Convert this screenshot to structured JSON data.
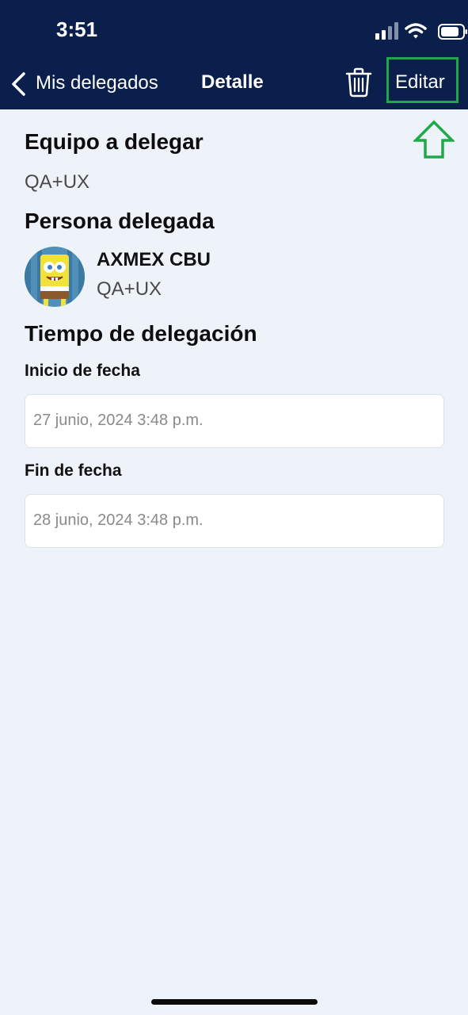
{
  "status_bar": {
    "time": "3:51"
  },
  "nav": {
    "back_label": "Mis delegados",
    "title": "Detalle",
    "edit_label": "Editar"
  },
  "sections": {
    "team_heading": "Equipo a delegar",
    "team_value": "QA+UX",
    "person_heading": "Persona delegada",
    "person_name": "AXMEX CBU",
    "person_team": "QA+UX",
    "time_heading": "Tiempo de delegación"
  },
  "dates": {
    "start_label": "Inicio de fecha",
    "start_value": "27 junio, 2024 3:48 p.m.",
    "end_label": "Fin de fecha",
    "end_value": "28 junio, 2024 3:48 p.m."
  },
  "colors": {
    "header_bg": "#0a1f4b",
    "page_bg": "#eef2f9",
    "highlight": "#1eaa48"
  },
  "icons": [
    "chevron-left-icon",
    "trash-icon",
    "arrow-up-icon",
    "signal-icon",
    "wifi-icon",
    "battery-icon"
  ]
}
